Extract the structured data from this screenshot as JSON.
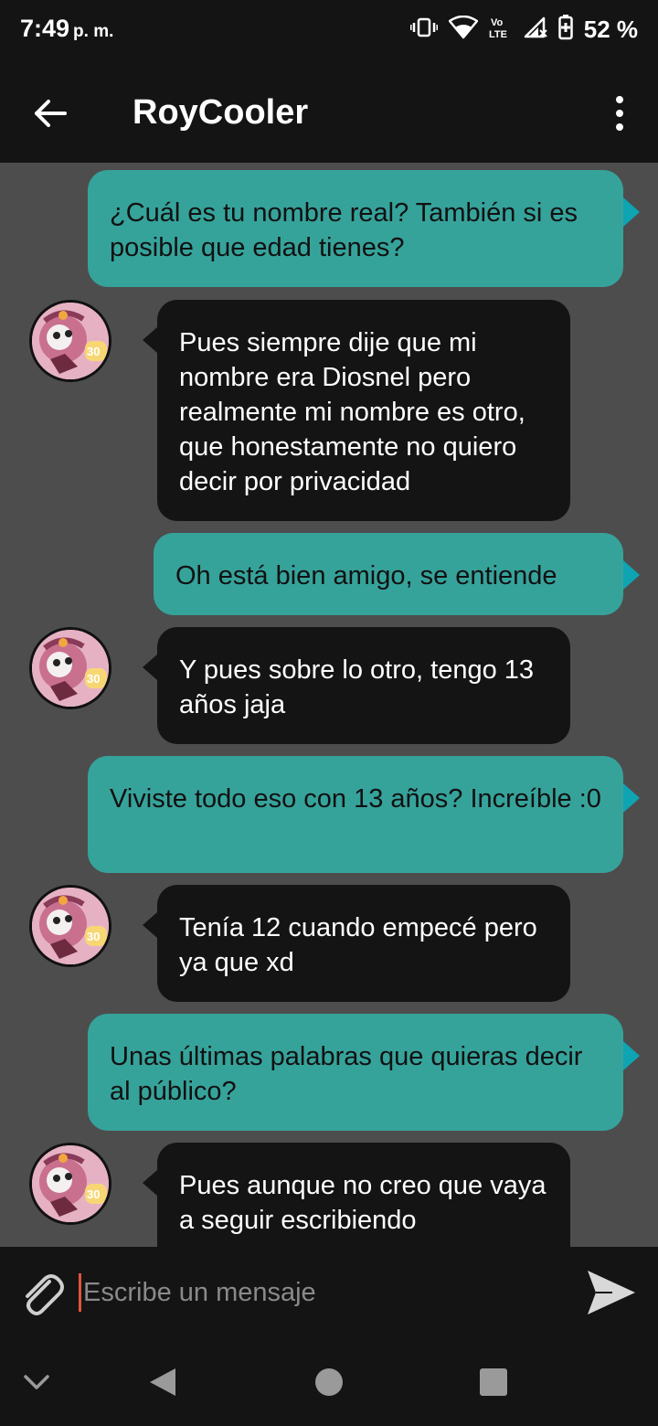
{
  "status_bar": {
    "time": "7:49",
    "ampm": "p. m.",
    "battery_percent": "52 %",
    "network_label": "Vo LTE"
  },
  "header": {
    "title": "RoyCooler",
    "back_icon": "arrow-left-icon",
    "menu_icon": "more-vertical-icon"
  },
  "messages": [
    {
      "direction": "out",
      "text": "¿Cuál es tu nombre real? También si es posible que edad tienes?"
    },
    {
      "direction": "in",
      "text": "Pues siempre dije que mi nombre era Diosnel pero realmente mi nombre es otro, que honestamente no quiero decir por privacidad"
    },
    {
      "direction": "out",
      "text": "Oh está bien amigo, se entiende"
    },
    {
      "direction": "in",
      "text": "Y pues sobre lo otro, tengo 13 años jaja"
    },
    {
      "direction": "out",
      "text": "Viviste todo eso con 13 años? Increíble :0"
    },
    {
      "direction": "in",
      "text": "Tenía 12 cuando empecé pero ya que xd"
    },
    {
      "direction": "out",
      "text": "Unas últimas palabras que quieras decir al público?"
    },
    {
      "direction": "in",
      "text": "Pues aunque no creo que vaya a seguir escribiendo"
    }
  ],
  "composer": {
    "placeholder": "Escribe un mensaje",
    "attach_icon": "paperclip-icon",
    "send_icon": "send-icon"
  },
  "nav_bar": {
    "icons": [
      "chevron-down-icon",
      "back-triangle-icon",
      "home-circle-icon",
      "recents-square-icon"
    ]
  },
  "colors": {
    "outgoing_bubble": "#36a39b",
    "incoming_bubble": "#141414",
    "chat_background": "#4d4d4d",
    "bar_background": "#141414",
    "outgoing_tail": "#0fa4b1",
    "cursor": "#e0553a"
  }
}
